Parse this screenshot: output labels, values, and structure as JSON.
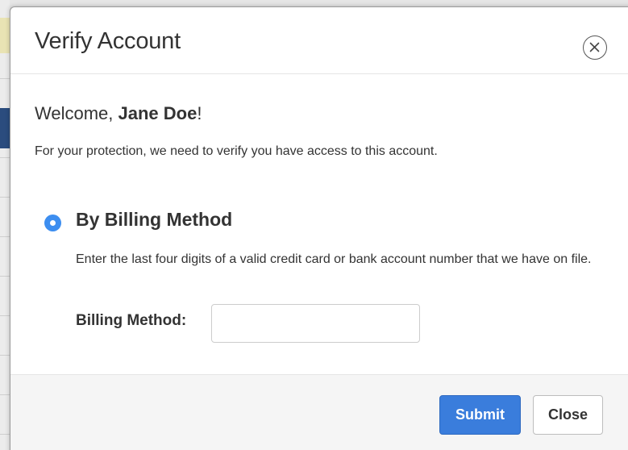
{
  "modal": {
    "title": "Verify Account",
    "close_icon": "close-circle-icon"
  },
  "body": {
    "welcome_prefix": "Welcome, ",
    "user_name": "Jane Doe",
    "welcome_suffix": "!",
    "protection_text": "For your protection, we need to verify you have access to this account.",
    "option": {
      "label": "By Billing Method",
      "selected": true,
      "description": "Enter the last four digits of a valid credit card or bank account number that we have on file.",
      "field_label": "Billing Method:",
      "field_value": ""
    }
  },
  "footer": {
    "submit_label": "Submit",
    "close_label": "Close"
  },
  "colors": {
    "primary": "#3a7ddc",
    "radio": "#3d8ef0"
  }
}
